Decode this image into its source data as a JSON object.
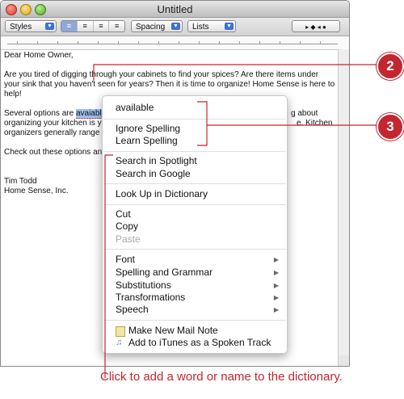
{
  "window": {
    "title": "Untitled"
  },
  "toolbar": {
    "styles": "Styles",
    "alignment": [
      "≡",
      "≡",
      "≡",
      "≡"
    ],
    "spacing": "Spacing",
    "lists": "Lists",
    "tab_controls": "▸ ◆ ◂ ●"
  },
  "document": {
    "greeting": "Dear Home Owner,",
    "para1": "Are you tired of digging through your cabinets to find your spices? Are there items under your sink that you haven't seen for years? Then it is time to organize! Home Sense is here to help!",
    "para2_before": "Several options are ",
    "para2_word": "avaiable",
    "para2_after_line1": "",
    "para2_right1": "g about",
    "para2_line2_left": "organizing your kitchen is y",
    "para2_line2_right": "e. Kitchen",
    "para2_line3_left": "organizers generally range",
    "para3_left": "Check out these options an",
    "signature_name": "Tim Todd",
    "signature_company": "Home Sense, Inc."
  },
  "context_menu": {
    "suggestion": "available",
    "ignore": "Ignore Spelling",
    "learn": "Learn Spelling",
    "spotlight": "Search in Spotlight",
    "google": "Search in Google",
    "lookup": "Look Up in Dictionary",
    "cut": "Cut",
    "copy": "Copy",
    "paste": "Paste",
    "font": "Font",
    "spelling_grammar": "Spelling and Grammar",
    "substitutions": "Substitutions",
    "transformations": "Transformations",
    "speech": "Speech",
    "mail_note": "Make New Mail Note",
    "itunes": "Add to iTunes as a Spoken Track"
  },
  "callouts": {
    "two": "2",
    "three": "3"
  },
  "caption": "Click to add a word or name to the dictionary.",
  "colors": {
    "callout": "#c4252f",
    "selection": "#9ec1f1"
  }
}
